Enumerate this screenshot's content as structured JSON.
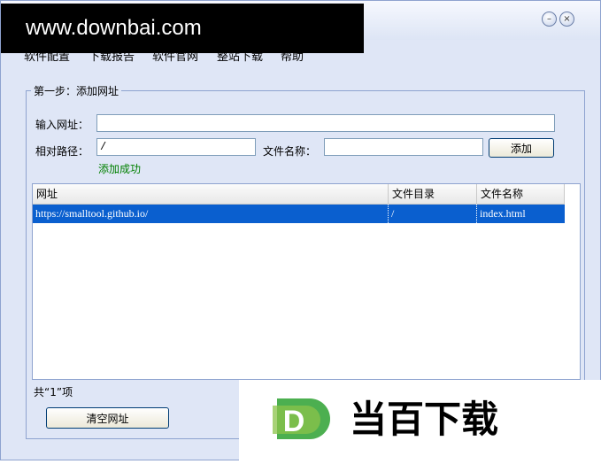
{
  "watermark": {
    "text": "www.downbai.com"
  },
  "titlebar": {
    "minimize": "–",
    "close": "×"
  },
  "menu": [
    "软件配置",
    "下载报告",
    "软件官网",
    "整站下载",
    "帮助"
  ],
  "step1": {
    "title": "第一步：添加网址",
    "url_label": "输入网址：",
    "url_value": "",
    "path_label": "相对路径：",
    "path_value": "/",
    "filename_label": "文件名称：",
    "filename_value": "",
    "add_button": "添加",
    "success_text": "添加成功",
    "columns": [
      "网址",
      "文件目录",
      "文件名称"
    ],
    "rows": [
      {
        "url": "https://smalltool.github.io/",
        "dir": "/",
        "file": "index.html"
      }
    ],
    "count_text": "共“1”项",
    "clear_button": "清空网址"
  },
  "logo": {
    "letter": "D",
    "text": "当百下载"
  },
  "colors": {
    "accent": "#0a5fcf",
    "success": "#008000",
    "window_bg": "#dfe6f6",
    "logo_green": "#5cb85c"
  }
}
